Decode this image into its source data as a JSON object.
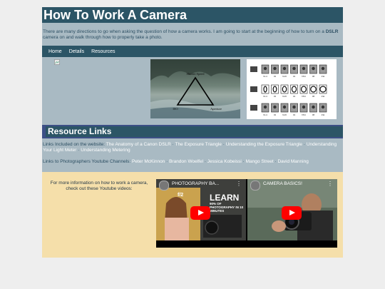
{
  "header": {
    "title": "How To Work A Camera"
  },
  "intro": {
    "text_before": "There are many directions to go when asking the question of how a camera works. I am going to start at the beginning of how to turn on a ",
    "bold": "DSLR",
    "text_after": " camera on and walk through how to properly take a photo."
  },
  "nav": {
    "items": [
      "Home",
      "Details",
      "Resources"
    ]
  },
  "gallery": {
    "triangle": {
      "top": "Shutter Speed",
      "left": "ISO",
      "right": "Aperture"
    },
    "chart": {
      "labels": [
        "f/1.4",
        "f/2",
        "f/2.8",
        "f/4",
        "f/5.6",
        "f/8",
        "f/11"
      ]
    }
  },
  "resources": {
    "heading": "Resource Links",
    "website_label": "Links Included on the website:",
    "website_links": [
      "The Anatomy of a Canon DSLR",
      "The Exposure Triangle",
      "Understanding the Exposure Triangle",
      "Understanding Your Light Meter",
      "Understanding Metering"
    ],
    "youtube_label": "Links to Photographers Youtube Channels:",
    "youtube_links": [
      "Peter McKinnon",
      "Brandon Woelfel",
      "Jessica Kobeissi",
      "Mango Street",
      "David Manning"
    ]
  },
  "videos": {
    "text": "For more information on how to work a camera, check out these Youtube videos:",
    "items": [
      {
        "title": "PHOTOGRAPHY BA...",
        "thumb_big": "LEARN",
        "thumb_small": "90% OF PHOTOGRAPHY IN 10 MINUTES",
        "thumb_fstop": "f/2"
      },
      {
        "title": "CAMERA BASICS!"
      }
    ]
  },
  "colors": {
    "header": "#2c5566",
    "panel": "#a9bac3",
    "accent": "#3c4f86",
    "video_bg": "#f5dfaa"
  }
}
